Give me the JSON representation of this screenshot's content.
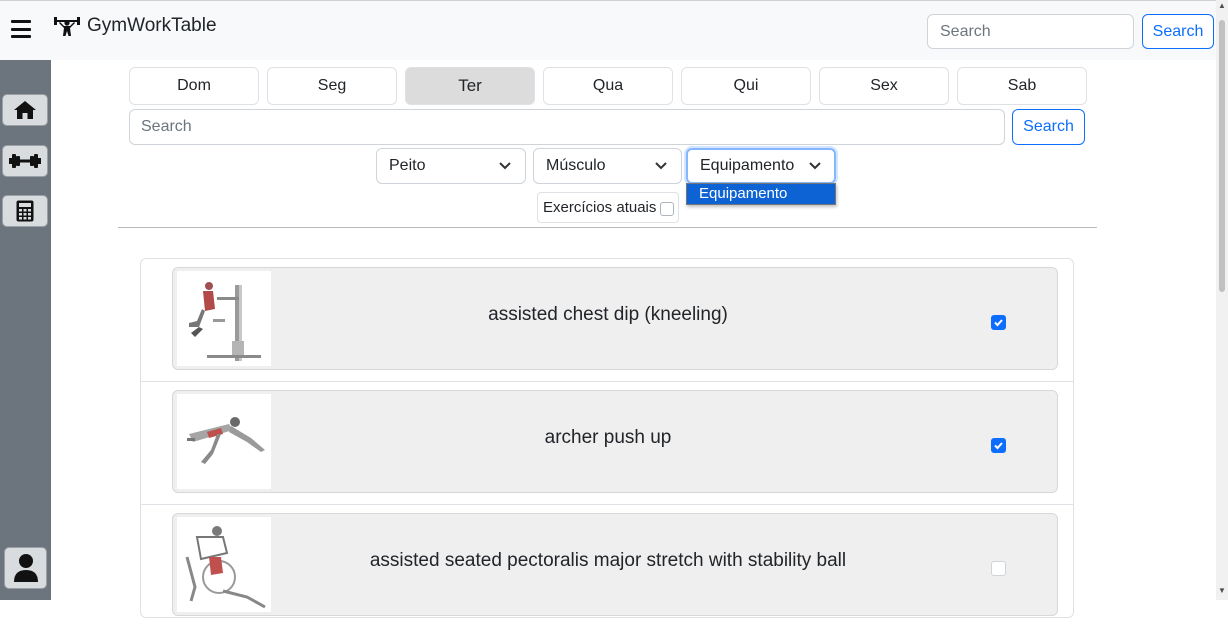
{
  "brand": {
    "title": "GymWorkTable",
    "logo_icon": "weightlifter-icon"
  },
  "top_search": {
    "placeholder": "Search",
    "button_label": "Search"
  },
  "sidebar": {
    "items": [
      {
        "icon": "home-icon"
      },
      {
        "icon": "dumbbell-icon"
      },
      {
        "icon": "calculator-icon"
      }
    ],
    "profile_icon": "user-icon"
  },
  "days": [
    {
      "label": "Dom",
      "active": false
    },
    {
      "label": "Seg",
      "active": false
    },
    {
      "label": "Ter",
      "active": true
    },
    {
      "label": "Qua",
      "active": false
    },
    {
      "label": "Qui",
      "active": false
    },
    {
      "label": "Sex",
      "active": false
    },
    {
      "label": "Sab",
      "active": false
    }
  ],
  "search": {
    "placeholder": "Search",
    "button_label": "Search"
  },
  "filters": {
    "body_part": "Peito",
    "muscle": "Músculo",
    "equipment": "Equipamento",
    "equipment_open_option": "Equipamento"
  },
  "current_toggle": {
    "label": "Exercícios atuais",
    "checked": false
  },
  "exercises": [
    {
      "name": "assisted chest dip (kneeling)",
      "checked": true
    },
    {
      "name": "archer push up",
      "checked": true
    },
    {
      "name": "assisted seated pectoralis major stretch with stability ball",
      "checked": false
    }
  ],
  "colors": {
    "accent": "#0d6efd",
    "sidebar_bg": "#6c757d",
    "card_bg": "#efefef",
    "selected_option": "#0d63d3"
  }
}
